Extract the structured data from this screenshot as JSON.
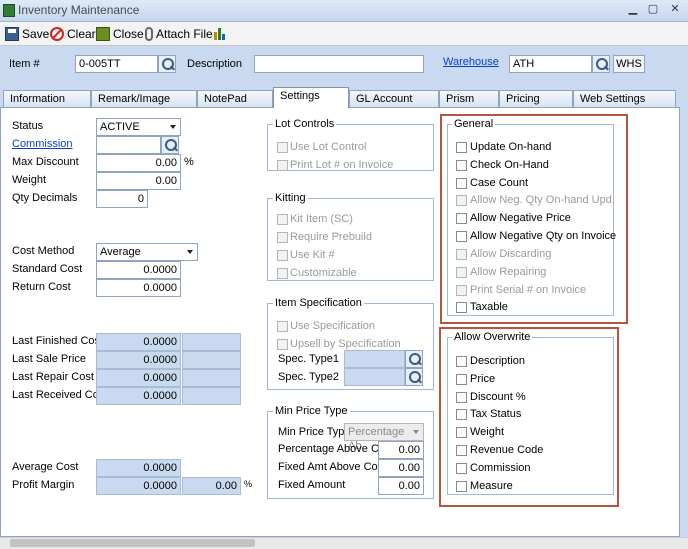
{
  "window": {
    "title": "Inventory Maintenance"
  },
  "toolbar": {
    "save": "Save",
    "clear": "Clear",
    "close": "Close",
    "attach": "Attach File"
  },
  "header": {
    "item_label": "Item #",
    "item_value": "0-005TT",
    "description_label": "Description",
    "description_value": "",
    "warehouse_label": "Warehouse",
    "warehouse_value": "ATH",
    "warehouse_code": "WHS"
  },
  "tabs": [
    "Information",
    "Remark/Image",
    "NotePad",
    "Settings",
    "GL Account",
    "Prism",
    "Pricing",
    "Web Settings"
  ],
  "left": {
    "status_label": "Status",
    "status_value": "ACTIVE",
    "commission_label": "Commission",
    "commission_value": "",
    "max_discount_label": "Max Discount",
    "max_discount_value": "0.00",
    "max_discount_unit": "%",
    "weight_label": "Weight",
    "weight_value": "0.00",
    "qty_decimals_label": "Qty Decimals",
    "qty_decimals_value": "0",
    "cost_method_label": "Cost Method",
    "cost_method_value": "Average",
    "standard_cost_label": "Standard Cost",
    "standard_cost_value": "0.0000",
    "return_cost_label": "Return Cost",
    "return_cost_value": "0.0000",
    "last_finished_label": "Last Finished Cost",
    "last_finished_value": "0.0000",
    "last_sale_label": "Last Sale Price",
    "last_sale_value": "0.0000",
    "last_repair_label": "Last Repair Cost",
    "last_repair_value": "0.0000",
    "last_received_label": "Last Received Cost",
    "last_received_value": "0.0000",
    "average_cost_label": "Average Cost",
    "average_cost_value": "0.0000",
    "profit_margin_label": "Profit Margin",
    "profit_margin_value": "0.0000",
    "profit_margin_pct": "0.00",
    "profit_margin_unit": "%"
  },
  "lot_controls": {
    "title": "Lot Controls",
    "items": [
      "Use Lot Control",
      "Print Lot # on Invoice"
    ]
  },
  "kitting": {
    "title": "Kitting",
    "items": [
      "Kit Item (SC)",
      "Require Prebuild",
      "Use Kit #",
      "Customizable"
    ]
  },
  "item_spec": {
    "title": "Item Specification",
    "items": [
      "Use Specification",
      "Upsell by Specification"
    ],
    "type1_label": "Spec. Type1",
    "type2_label": "Spec. Type2"
  },
  "min_price": {
    "title": "Min Price Type",
    "type_label": "Min Price Type",
    "type_value": "Percentage Ab",
    "pct_above_label": "Percentage Above Cost",
    "pct_above_value": "0.00",
    "fixed_above_label": "Fixed Amt Above Cost",
    "fixed_above_value": "0.00",
    "fixed_amount_label": "Fixed Amount",
    "fixed_amount_value": "0.00"
  },
  "general": {
    "title": "General",
    "items": [
      "Update On-hand",
      "Check On-Hand",
      "Case Count",
      "Allow Neg. Qty On-hand Upd.",
      "Allow Negative Price",
      "Allow Negative Qty on Invoice",
      "Allow Discarding",
      "Allow Repairing",
      "Print Serial # on Invoice",
      "Taxable"
    ]
  },
  "allow_overwrite": {
    "title": "Allow Overwrite",
    "items": [
      "Description",
      "Price",
      "Discount %",
      "Tax Status",
      "Weight",
      "Revenue Code",
      "Commission",
      "Measure"
    ]
  },
  "colors": {
    "highlight_box": "#b5553e",
    "panel_bg": "#c9daf0",
    "link": "#0b3fc9"
  }
}
